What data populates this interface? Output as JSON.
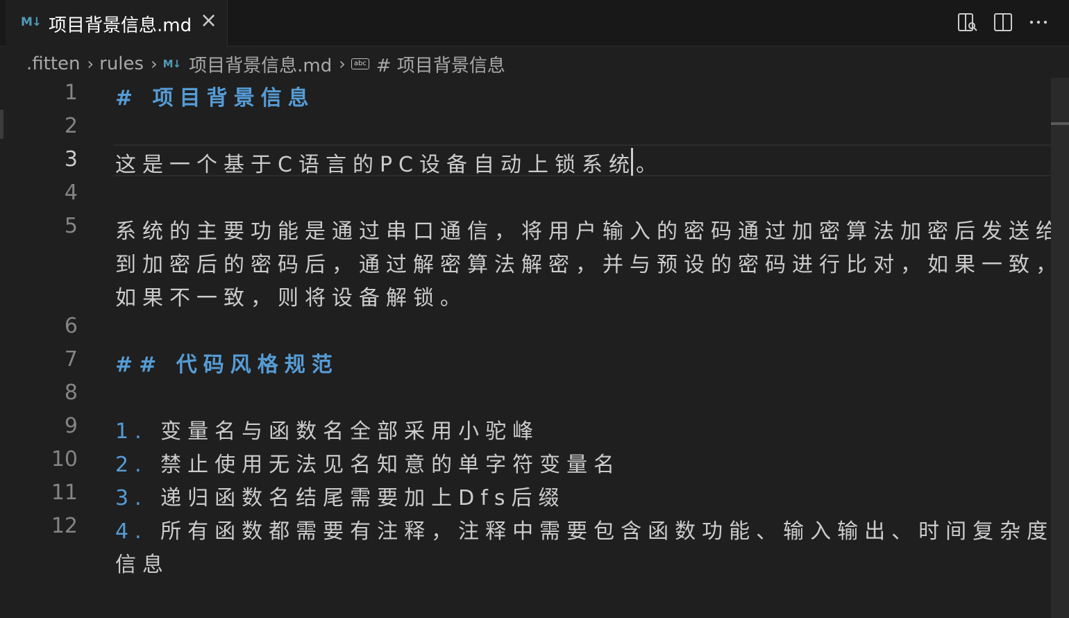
{
  "tab": {
    "icon_text": "M↓",
    "title": "项目背景信息.md",
    "close": "×"
  },
  "breadcrumb": {
    "folder1": ".fitten",
    "folder2": "rules",
    "file": "项目背景信息.md",
    "symbol_icon_text": "abc",
    "symbol": "# 项目背景信息"
  },
  "editor": {
    "line_numbers": [
      "1",
      "2",
      "3",
      "4",
      "5",
      "6",
      "7",
      "8",
      "9",
      "10",
      "11",
      "12"
    ],
    "active_line": "3",
    "lines": {
      "l1": "# 项目背景信息",
      "l3": "这是一个基于C语言的PC设备自动上锁系统。",
      "l5a": "系统的主要功能是通过串口通信，将用户输入的密码通过加密算法加密后发送给设",
      "l5b": "到加密后的密码后，通过解密算法解密，并与预设的密码进行比对，如果一致，则",
      "l5c": "如果不一致，则将设备解锁。",
      "l7": "## 代码风格规范",
      "l9_num": "1.",
      "l9": "变量名与函数名全部采用小驼峰",
      "l10_num": "2.",
      "l10": "禁止使用无法见名知意的单字符变量名",
      "l11_num": "3.",
      "l11": "递归函数名结尾需要加上Dfs后缀",
      "l12_num": "4.",
      "l12a": "所有函数都需要有注释，注释中需要包含函数功能、输入输出、时间复杂度、空",
      "l12b": "信息"
    }
  },
  "colors": {
    "background": "#1f1f1f",
    "tabbar": "#181818",
    "markdown_accent": "#569cd6",
    "text": "#cccccc"
  }
}
